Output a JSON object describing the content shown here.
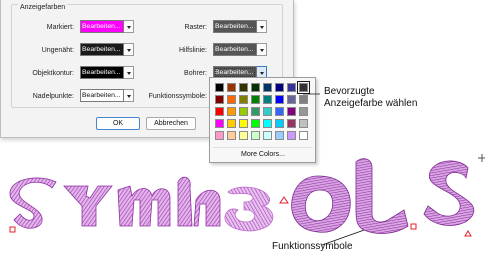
{
  "dialog": {
    "group_title": "Anzeigefarben",
    "fields": [
      {
        "label": "Markiert:",
        "value": "Bearbeiten...",
        "bg": "#ff00ff",
        "fg": "#ffffff"
      },
      {
        "label": "Ungenäht:",
        "value": "Bearbeiten...",
        "bg": "#1a1a1a",
        "fg": "#ffffff"
      },
      {
        "label": "Objektkontur:",
        "value": "Bearbeiten...",
        "bg": "#000000",
        "fg": "#ffffff"
      },
      {
        "label": "Nadelpunkte:",
        "value": "Bearbeiten...",
        "bg": "#ffffff",
        "fg": "#111111"
      },
      {
        "label": "Raster:",
        "value": "Bearbeiten...",
        "bg": "#555555",
        "fg": "#ffffff"
      },
      {
        "label": "Hilfslinie:",
        "value": "Bearbeiten...",
        "bg": "#555555",
        "fg": "#ffffff"
      },
      {
        "label": "Bohrer:",
        "value": "Bearbeiten...",
        "bg": "#555555",
        "fg": "#ffffff"
      },
      {
        "label": "Funktionssymbole:",
        "value": "Bearbeiten...",
        "bg": "#ffffff",
        "fg": "#111111"
      }
    ],
    "ok_label": "OK",
    "cancel_label": "Abbrechen"
  },
  "palette": {
    "colors": [
      "#000000",
      "#993300",
      "#333300",
      "#003300",
      "#003366",
      "#000080",
      "#333399",
      "#333333",
      "#800000",
      "#ff6600",
      "#808000",
      "#008000",
      "#008080",
      "#0000ff",
      "#666699",
      "#808080",
      "#ff0000",
      "#ff9900",
      "#99cc00",
      "#339966",
      "#33cccc",
      "#3366ff",
      "#800080",
      "#969696",
      "#ff00ff",
      "#ffcc00",
      "#ffff00",
      "#00ff00",
      "#00ffff",
      "#00ccff",
      "#993366",
      "#c0c0c0",
      "#ff99cc",
      "#ffcc99",
      "#ffff99",
      "#ccffcc",
      "#ccffff",
      "#99ccff",
      "#cc99ff",
      "#ffffff"
    ],
    "selected_index": 7,
    "more_label": "More Colors..."
  },
  "callouts": {
    "preferred_line1": "Bevorzugte",
    "preferred_line2": "Anzeigefarbe wählen",
    "symbols": "Funktionssymbole"
  },
  "colors": {
    "stitch": "#b44cc4",
    "stitch_dark": "#7e2a93",
    "markers": "#e0202a"
  }
}
